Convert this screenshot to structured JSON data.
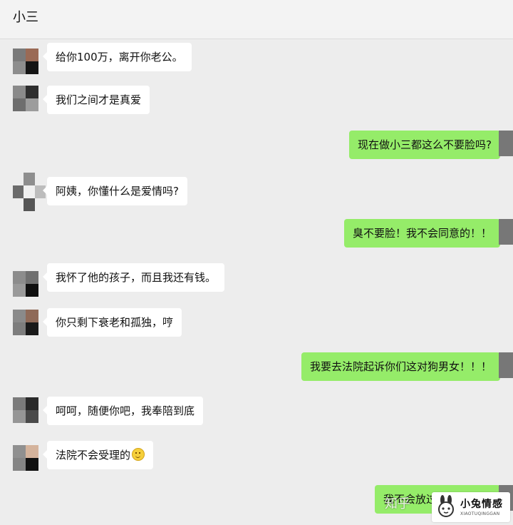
{
  "header": {
    "title": "小三"
  },
  "messages": [
    {
      "side": "in",
      "text": "给你100万，离开你老公。"
    },
    {
      "side": "in",
      "text": "我们之间才是真爱"
    },
    {
      "side": "out",
      "text": "现在做小三都这么不要脸吗?"
    },
    {
      "side": "in",
      "text": "阿姨，你懂什么是爱情吗?"
    },
    {
      "side": "out",
      "text": "臭不要脸！我不会同意的！！"
    },
    {
      "side": "in",
      "text": "我怀了他的孩子，而且我还有钱。"
    },
    {
      "side": "in",
      "text": "你只剩下衰老和孤独，哼"
    },
    {
      "side": "out",
      "text": "我要去法院起诉你们这对狗男女！！！"
    },
    {
      "side": "in",
      "text": "呵呵，随便你吧，我奉陪到底"
    },
    {
      "side": "in",
      "text": "法院不会受理的",
      "emoji": "smile-emoji"
    },
    {
      "side": "out",
      "text": "我不会放过"
    }
  ],
  "watermark": {
    "text": "知乎"
  },
  "logo": {
    "text": "小兔情感",
    "subtext": "XIAOTUQINGGAN"
  },
  "colors": {
    "outgoing": "#95ec69",
    "incoming": "#ffffff",
    "background": "#ededed"
  }
}
